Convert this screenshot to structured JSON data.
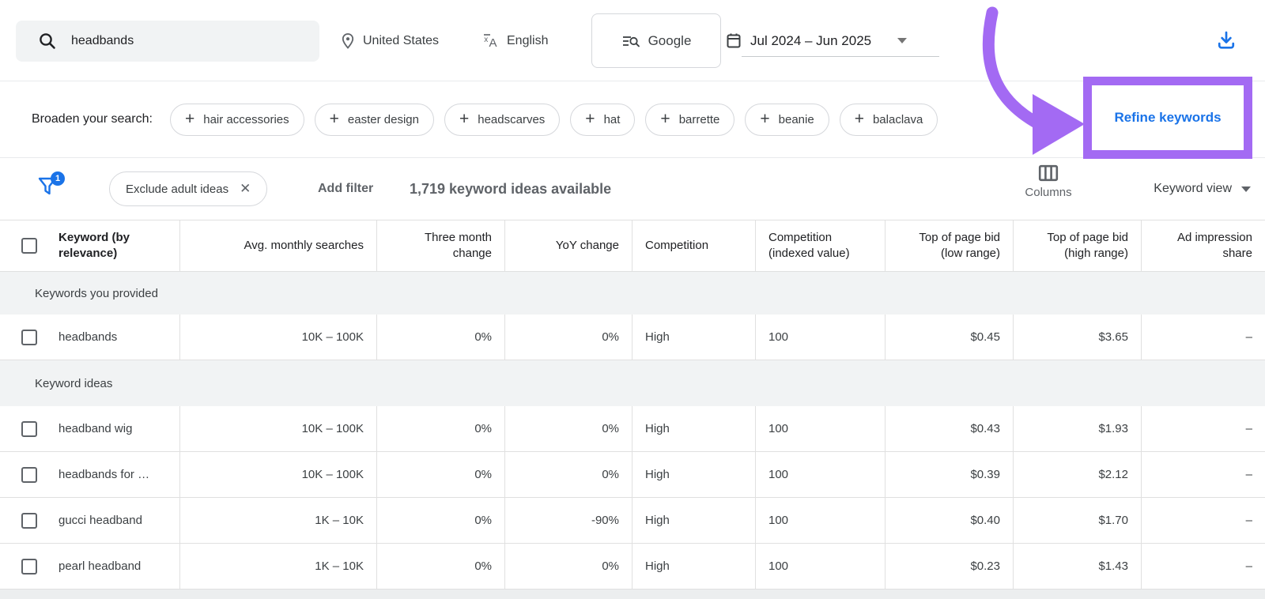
{
  "topbar": {
    "search_value": "headbands",
    "location_label": "United States",
    "language_label": "English",
    "network_label": "Google",
    "date_range_label": "Jul 2024 – Jun 2025"
  },
  "broaden": {
    "label": "Broaden your search:",
    "chips": [
      "hair accessories",
      "easter design",
      "headscarves",
      "hat",
      "barrette",
      "beanie",
      "balaclava"
    ]
  },
  "annotation": {
    "refine_label": "Refine keywords"
  },
  "filterbar": {
    "badge_count": "1",
    "filter_chip_label": "Exclude adult ideas",
    "add_filter_label": "Add filter",
    "ideas_available": "1,719 keyword ideas available",
    "columns_label": "Columns",
    "view_label": "Keyword view"
  },
  "table": {
    "headers": [
      "Keyword (by relevance)",
      "Avg. monthly searches",
      "Three month change",
      "YoY change",
      "Competition",
      "Competition (indexed value)",
      "Top of page bid (low range)",
      "Top of page bid (high range)",
      "Ad impression share"
    ],
    "sections": [
      {
        "label": "Keywords you provided",
        "rows": [
          [
            "headbands",
            "10K – 100K",
            "0%",
            "0%",
            "High",
            "100",
            "$0.45",
            "$3.65",
            "–"
          ]
        ]
      },
      {
        "label": "Keyword ideas",
        "rows": [
          [
            "headband wig",
            "10K – 100K",
            "0%",
            "0%",
            "High",
            "100",
            "$0.43",
            "$1.93",
            "–"
          ],
          [
            "headbands for …",
            "10K – 100K",
            "0%",
            "0%",
            "High",
            "100",
            "$0.39",
            "$2.12",
            "–"
          ],
          [
            "gucci headband",
            "1K – 10K",
            "0%",
            "-90%",
            "High",
            "100",
            "$0.40",
            "$1.70",
            "–"
          ],
          [
            "pearl headband",
            "1K – 10K",
            "0%",
            "0%",
            "High",
            "100",
            "$0.23",
            "$1.43",
            "–"
          ]
        ]
      }
    ]
  },
  "colors": {
    "accent_blue": "#1a73e8",
    "annotation_purple": "#a36af3",
    "text_dark": "#202124",
    "text_gray": "#5f6368",
    "border": "#e0e0e0"
  }
}
